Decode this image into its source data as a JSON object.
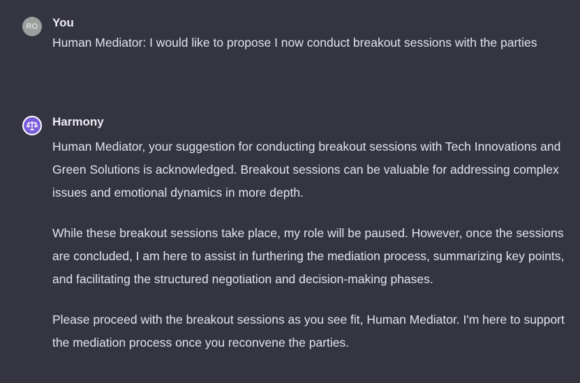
{
  "conversation": {
    "user_message": {
      "avatar_initials": "RO",
      "author": "You",
      "text": "Human Mediator: I would like to propose I now conduct breakout sessions with the parties"
    },
    "assistant_message": {
      "avatar_icon": "scales-icon",
      "author": "Harmony",
      "paragraphs": [
        "Human Mediator, your suggestion for conducting breakout sessions with Tech Innovations and Green Solutions is acknowledged. Breakout sessions can be valuable for addressing complex issues and emotional dynamics in more depth.",
        "While these breakout sessions take place, my role will be paused. However, once the sessions are concluded, I am here to assist in furthering the mediation process, summarizing key points, and facilitating the structured negotiation and decision-making phases.",
        "Please proceed with the breakout sessions as you see fit, Human Mediator. I'm here to support the mediation process once you reconvene the parties."
      ]
    }
  },
  "colors": {
    "background": "#343541",
    "text": "#ececf1",
    "user_avatar": "#9aa09c",
    "assistant_avatar": "#7b5ed9"
  }
}
